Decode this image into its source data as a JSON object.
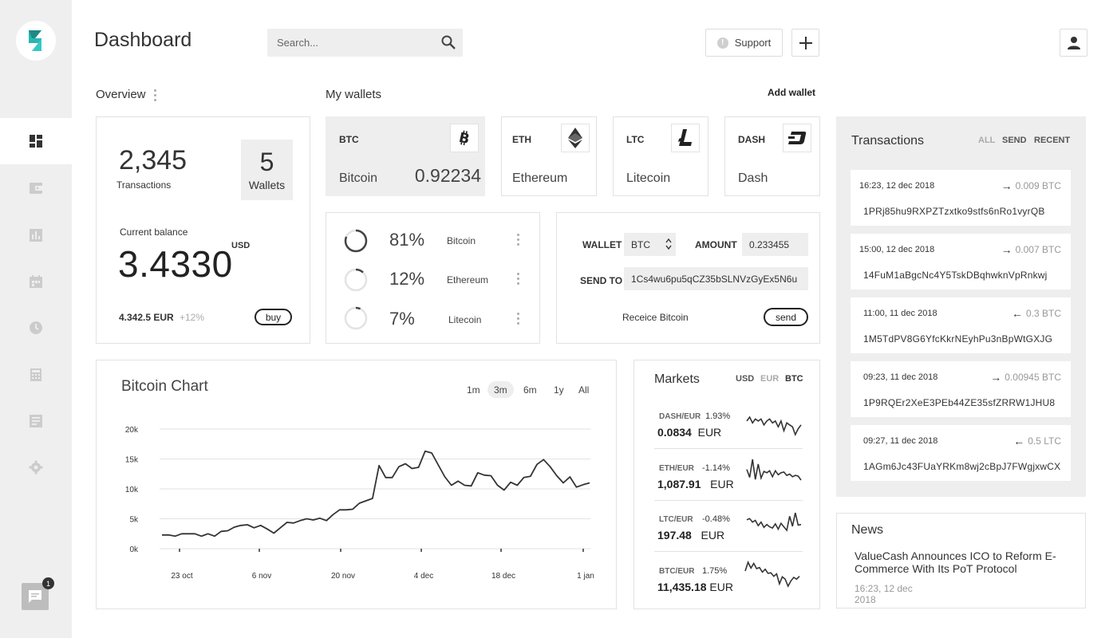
{
  "sidebar": {
    "nav": [
      {
        "icon": "dashboard-icon",
        "active": true
      },
      {
        "icon": "wallet-icon",
        "active": false
      },
      {
        "icon": "bar-chart-icon",
        "active": false
      },
      {
        "icon": "calendar-icon",
        "active": false
      },
      {
        "icon": "clock-icon",
        "active": false
      },
      {
        "icon": "calculator-icon",
        "active": false
      },
      {
        "icon": "document-icon",
        "active": false
      },
      {
        "icon": "settings-icon",
        "active": false
      }
    ],
    "chat_badge": "1"
  },
  "header": {
    "title": "Dashboard",
    "search_placeholder": "Search...",
    "support_label": "Support"
  },
  "overview": {
    "title": "Overview",
    "transactions_count": "2,345",
    "transactions_label": "Transactions",
    "wallets_count": "5",
    "wallets_label": "Wallets",
    "balance_label": "Current balance",
    "balance_currency": "USD",
    "balance_value": "3.4330",
    "eur_value": "4.342.5 EUR",
    "eur_change": "+12%",
    "buy_label": "buy"
  },
  "wallets": {
    "title": "My wallets",
    "add_label": "Add wallet",
    "cards": [
      {
        "code": "BTC",
        "name": "Bitcoin",
        "amount": "0.92234",
        "icon": "bitcoin-icon",
        "selected": true
      },
      {
        "code": "ETH",
        "name": "Ethereum",
        "amount": "",
        "icon": "ethereum-icon",
        "selected": false
      },
      {
        "code": "LTC",
        "name": "Litecoin",
        "amount": "",
        "icon": "litecoin-icon",
        "selected": false
      },
      {
        "code": "DASH",
        "name": "Dash",
        "amount": "",
        "icon": "dash-icon",
        "selected": false
      }
    ]
  },
  "distribution": [
    {
      "percent": "81%",
      "coin": "Bitcoin",
      "fraction": 0.81
    },
    {
      "percent": "12%",
      "coin": "Ethereum",
      "fraction": 0.12
    },
    {
      "percent": "7%",
      "coin": "Litecoin",
      "fraction": 0.07
    }
  ],
  "send_form": {
    "wallet_label": "WALLET",
    "wallet_value": "BTC",
    "amount_label": "AMOUNT",
    "amount_value": "0.233455",
    "send_to_label": "SEND TO",
    "send_to_value": "1Cs4wu6pu5qCZ35bSLNVzGyEx5N6u",
    "receive_label": "Receice Bitcoin",
    "send_label": "send"
  },
  "chart_data": {
    "type": "line",
    "title": "Bitcoin Chart",
    "ranges": [
      "1m",
      "3m",
      "6m",
      "1y",
      "All"
    ],
    "selected_range": "3m",
    "x_ticks": [
      "23 oct",
      "6 nov",
      "20 nov",
      "4 dec",
      "18 dec",
      "1 jan"
    ],
    "y_ticks": [
      "20k",
      "15k",
      "10k",
      "5k",
      "0k"
    ],
    "ylim": [
      0,
      20000
    ],
    "grid": true,
    "values": [
      2300,
      2300,
      2100,
      2500,
      2500,
      2500,
      2100,
      2500,
      2100,
      2900,
      3000,
      3600,
      3900,
      4000,
      3500,
      3900,
      3300,
      2600,
      3500,
      4400,
      4300,
      4700,
      5000,
      4800,
      5100,
      4700,
      5700,
      6500,
      6500,
      6600,
      7600,
      8000,
      8400,
      13900,
      11900,
      11900,
      13700,
      14200,
      13400,
      13600,
      16300,
      16000,
      14000,
      12000,
      10600,
      11300,
      10600,
      10500,
      12700,
      12300,
      12200,
      10600,
      9800,
      11100,
      10600,
      11900,
      12100,
      14100,
      14900,
      13700,
      12200,
      11000,
      12000,
      10300,
      10700,
      11000
    ]
  },
  "markets": {
    "title": "Markets",
    "tabs": [
      {
        "label": "USD",
        "active": false
      },
      {
        "label": "EUR",
        "active": false
      },
      {
        "label": "BTC",
        "active": true
      }
    ],
    "items": [
      {
        "pair": "DASH/EUR",
        "change": "1.93%",
        "value": "0.0834",
        "currency": "EUR",
        "spark": [
          5,
          5.2,
          4.9,
          5.1,
          5.0,
          5.1,
          4.8,
          5.0,
          5.1,
          4.9,
          5.0,
          4.7,
          5.0,
          4.5,
          4.9,
          4.8,
          4.7,
          4.3,
          4.6,
          4.8
        ]
      },
      {
        "pair": "ETH/EUR",
        "change": "-1.14%",
        "value": "1,087.91",
        "currency": "EUR",
        "spark": [
          5,
          3.8,
          6.5,
          3.5,
          5.8,
          3.7,
          4.7,
          4.5,
          4.8,
          3.9,
          4.8,
          4.2,
          4.5,
          4.6,
          4.1,
          4.3,
          3.9,
          4.1,
          4.0,
          3.4
        ]
      },
      {
        "pair": "LTC/EUR",
        "change": "-0.48%",
        "value": "197.48",
        "currency": "EUR",
        "spark": [
          6,
          6.2,
          5.6,
          5.9,
          5.0,
          5.6,
          4.7,
          5.2,
          4.8,
          4.6,
          5.3,
          4.4,
          5.4,
          4.8,
          4.2,
          6.6,
          4.9,
          7.2,
          5.1,
          5.2
        ]
      },
      {
        "pair": "BTC/EUR",
        "change": "1.75%",
        "value": "11,435.18",
        "currency": "EUR",
        "spark": [
          5,
          6.5,
          5.5,
          6.3,
          5.4,
          5.6,
          4.8,
          5.3,
          4.6,
          4.7,
          4.1,
          4.5,
          2.8,
          4.0,
          3.6,
          2.4,
          3.3,
          3.9,
          3.6,
          4.1
        ]
      }
    ]
  },
  "transactions": {
    "title": "Transactions",
    "tabs": [
      {
        "label": "ALL",
        "active": false
      },
      {
        "label": "SEND",
        "active": true
      },
      {
        "label": "RECENT",
        "active": true
      }
    ],
    "items": [
      {
        "time": "16:23, 12 dec 2018",
        "direction": "out",
        "amount": "0.009 BTC",
        "address": "1PRj85hu9RXPZTzxtko9stfs6nRo1vyrQB"
      },
      {
        "time": "15:00, 12 dec 2018",
        "direction": "out",
        "amount": "0.007 BTC",
        "address": "14FuM1aBgcNc4Y5TskDBqhwknVpRnkwj"
      },
      {
        "time": "11:00, 11 dec 2018",
        "direction": "in",
        "amount": "0.3 BTC",
        "address": "1M5TdPV8G6YfcKkrNEyhPu3nBpWtGXJG"
      },
      {
        "time": "09:23, 11 dec 2018",
        "direction": "out",
        "amount": "0.00945 BTC",
        "address": "1P9RQEr2XeE3PEb44ZE35sfZRRW1JHU8"
      },
      {
        "time": "09:27, 11 dec 2018",
        "direction": "in",
        "amount": "0.5 LTC",
        "address": "1AGm6Jc43FUaYRKm8wj2cBpJ7FWgjxwCX"
      }
    ]
  },
  "news": {
    "title": "News",
    "headline": "ValueCash Announces ICO to Reform E-Commerce With Its PoT Protocol",
    "date": "16:23, 12 dec 2018"
  },
  "colors": {
    "accent": "#2bb5b1",
    "text": "#333333",
    "muted": "#999999",
    "panel": "#eeeeee"
  }
}
